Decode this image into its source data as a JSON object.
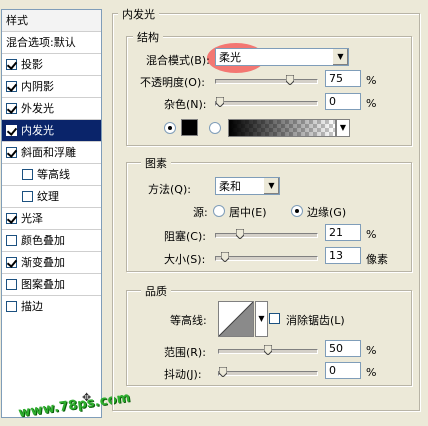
{
  "style_list": {
    "header": "样式",
    "blend_options": "混合选项:默认",
    "items": [
      {
        "label": "投影",
        "checked": true
      },
      {
        "label": "内阴影",
        "checked": true
      },
      {
        "label": "外发光",
        "checked": true
      },
      {
        "label": "内发光",
        "checked": true,
        "selected": true
      },
      {
        "label": "斜面和浮雕",
        "checked": true
      },
      {
        "label": "等高线",
        "checked": false,
        "indent": true
      },
      {
        "label": "纹理",
        "checked": false,
        "indent": true
      },
      {
        "label": "光泽",
        "checked": true
      },
      {
        "label": "颜色叠加",
        "checked": false
      },
      {
        "label": "渐变叠加",
        "checked": true
      },
      {
        "label": "图案叠加",
        "checked": false
      },
      {
        "label": "描边",
        "checked": false
      }
    ]
  },
  "inner_glow": {
    "title": "内发光",
    "structure": {
      "title": "结构",
      "blend_mode_label": "混合模式(B):",
      "blend_mode_value": "柔光",
      "opacity_label": "不透明度(O):",
      "opacity_value": "75",
      "opacity_unit": "%",
      "opacity_fraction": 0.75,
      "noise_label": "杂色(N):",
      "noise_value": "0",
      "noise_unit": "%",
      "noise_fraction": 0.0
    },
    "elements": {
      "title": "图素",
      "method_label": "方法(Q):",
      "method_value": "柔和",
      "source_label": "源:",
      "source_center": "居中(E)",
      "source_edge": "边缘(G)",
      "choke_label": "阻塞(C):",
      "choke_value": "21",
      "choke_unit": "%",
      "choke_fraction": 0.21,
      "size_label": "大小(S):",
      "size_value": "13",
      "size_unit": "像素",
      "size_fraction": 0.05
    },
    "quality": {
      "title": "品质",
      "contour_label": "等高线:",
      "antialias_label": "消除锯齿(L)",
      "range_label": "范围(R):",
      "range_value": "50",
      "range_unit": "%",
      "range_fraction": 0.5,
      "jitter_label": "抖动(J):",
      "jitter_value": "0",
      "jitter_unit": "%",
      "jitter_fraction": 0.0
    }
  },
  "watermark": "www.78ps.com",
  "colors": {
    "selected_bg": "#0a246a",
    "highlight": "#f55050",
    "watermark": "#2eae2e"
  }
}
